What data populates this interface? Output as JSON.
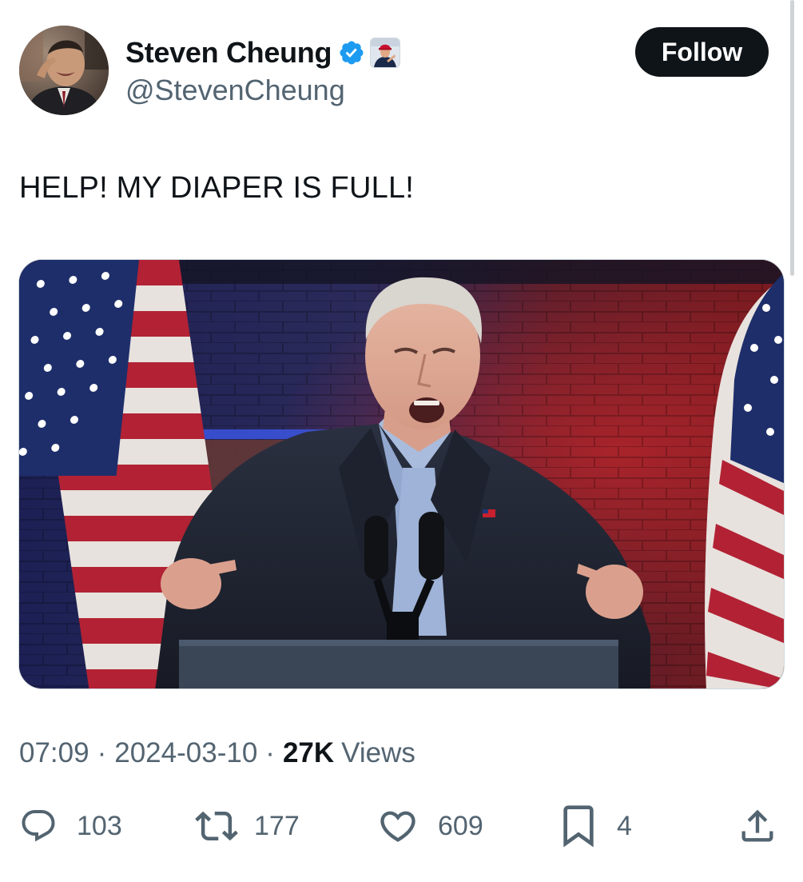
{
  "author": {
    "name": "Steven Cheung",
    "handle": "@StevenCheung",
    "verified": true
  },
  "follow_button": {
    "label": "Follow"
  },
  "tweet": {
    "text": "HELP! MY DIAPER IS FULL!",
    "time": "07:09",
    "separator": "·",
    "date": "2024-03-10",
    "views_count": "27K",
    "views_label": "Views"
  },
  "actions": {
    "replies": "103",
    "reposts": "177",
    "likes": "609",
    "bookmarks": "4"
  },
  "colors": {
    "text_primary": "#0f1419",
    "text_secondary": "#536471",
    "verified_blue": "#1d9bf0",
    "follow_bg": "#0f1419",
    "follow_text": "#ffffff"
  },
  "icons": [
    "verified-badge-icon",
    "reply-icon",
    "repost-icon",
    "like-icon",
    "bookmark-icon",
    "share-icon"
  ]
}
